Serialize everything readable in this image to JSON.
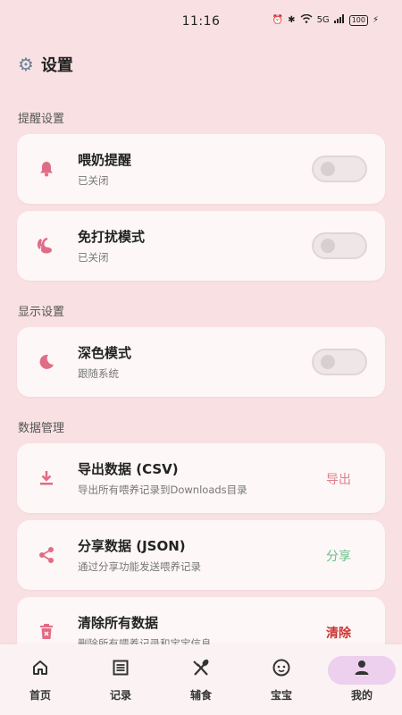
{
  "status": {
    "time": "11:16",
    "signal": "5G",
    "battery": "100"
  },
  "header": {
    "title": "设置"
  },
  "sections": {
    "reminders": "提醒设置",
    "display": "显示设置",
    "data": "数据管理"
  },
  "cards": {
    "feeding_reminder": {
      "title": "喂奶提醒",
      "subtitle": "已关闭"
    },
    "dnd_mode": {
      "title": "免打扰模式",
      "subtitle": "已关闭"
    },
    "dark_mode": {
      "title": "深色模式",
      "subtitle": "跟随系统"
    },
    "export": {
      "title": "导出数据 (CSV)",
      "subtitle": "导出所有喂养记录到Downloads目录",
      "action": "导出"
    },
    "share": {
      "title": "分享数据 (JSON)",
      "subtitle": "通过分享功能发送喂养记录",
      "action": "分享"
    },
    "clear": {
      "title": "清除所有数据",
      "subtitle": "删除所有喂养记录和宝宝信息",
      "action": "清除"
    }
  },
  "colors": {
    "accent": "#e06d86",
    "export_action": "#e0808f",
    "share_action": "#6cbf8a",
    "clear_action": "#cc3333"
  },
  "nav": [
    {
      "label": "首页",
      "icon": "home-icon"
    },
    {
      "label": "记录",
      "icon": "list-icon"
    },
    {
      "label": "辅食",
      "icon": "utensils-icon"
    },
    {
      "label": "宝宝",
      "icon": "baby-face-icon"
    },
    {
      "label": "我的",
      "icon": "person-icon"
    }
  ]
}
